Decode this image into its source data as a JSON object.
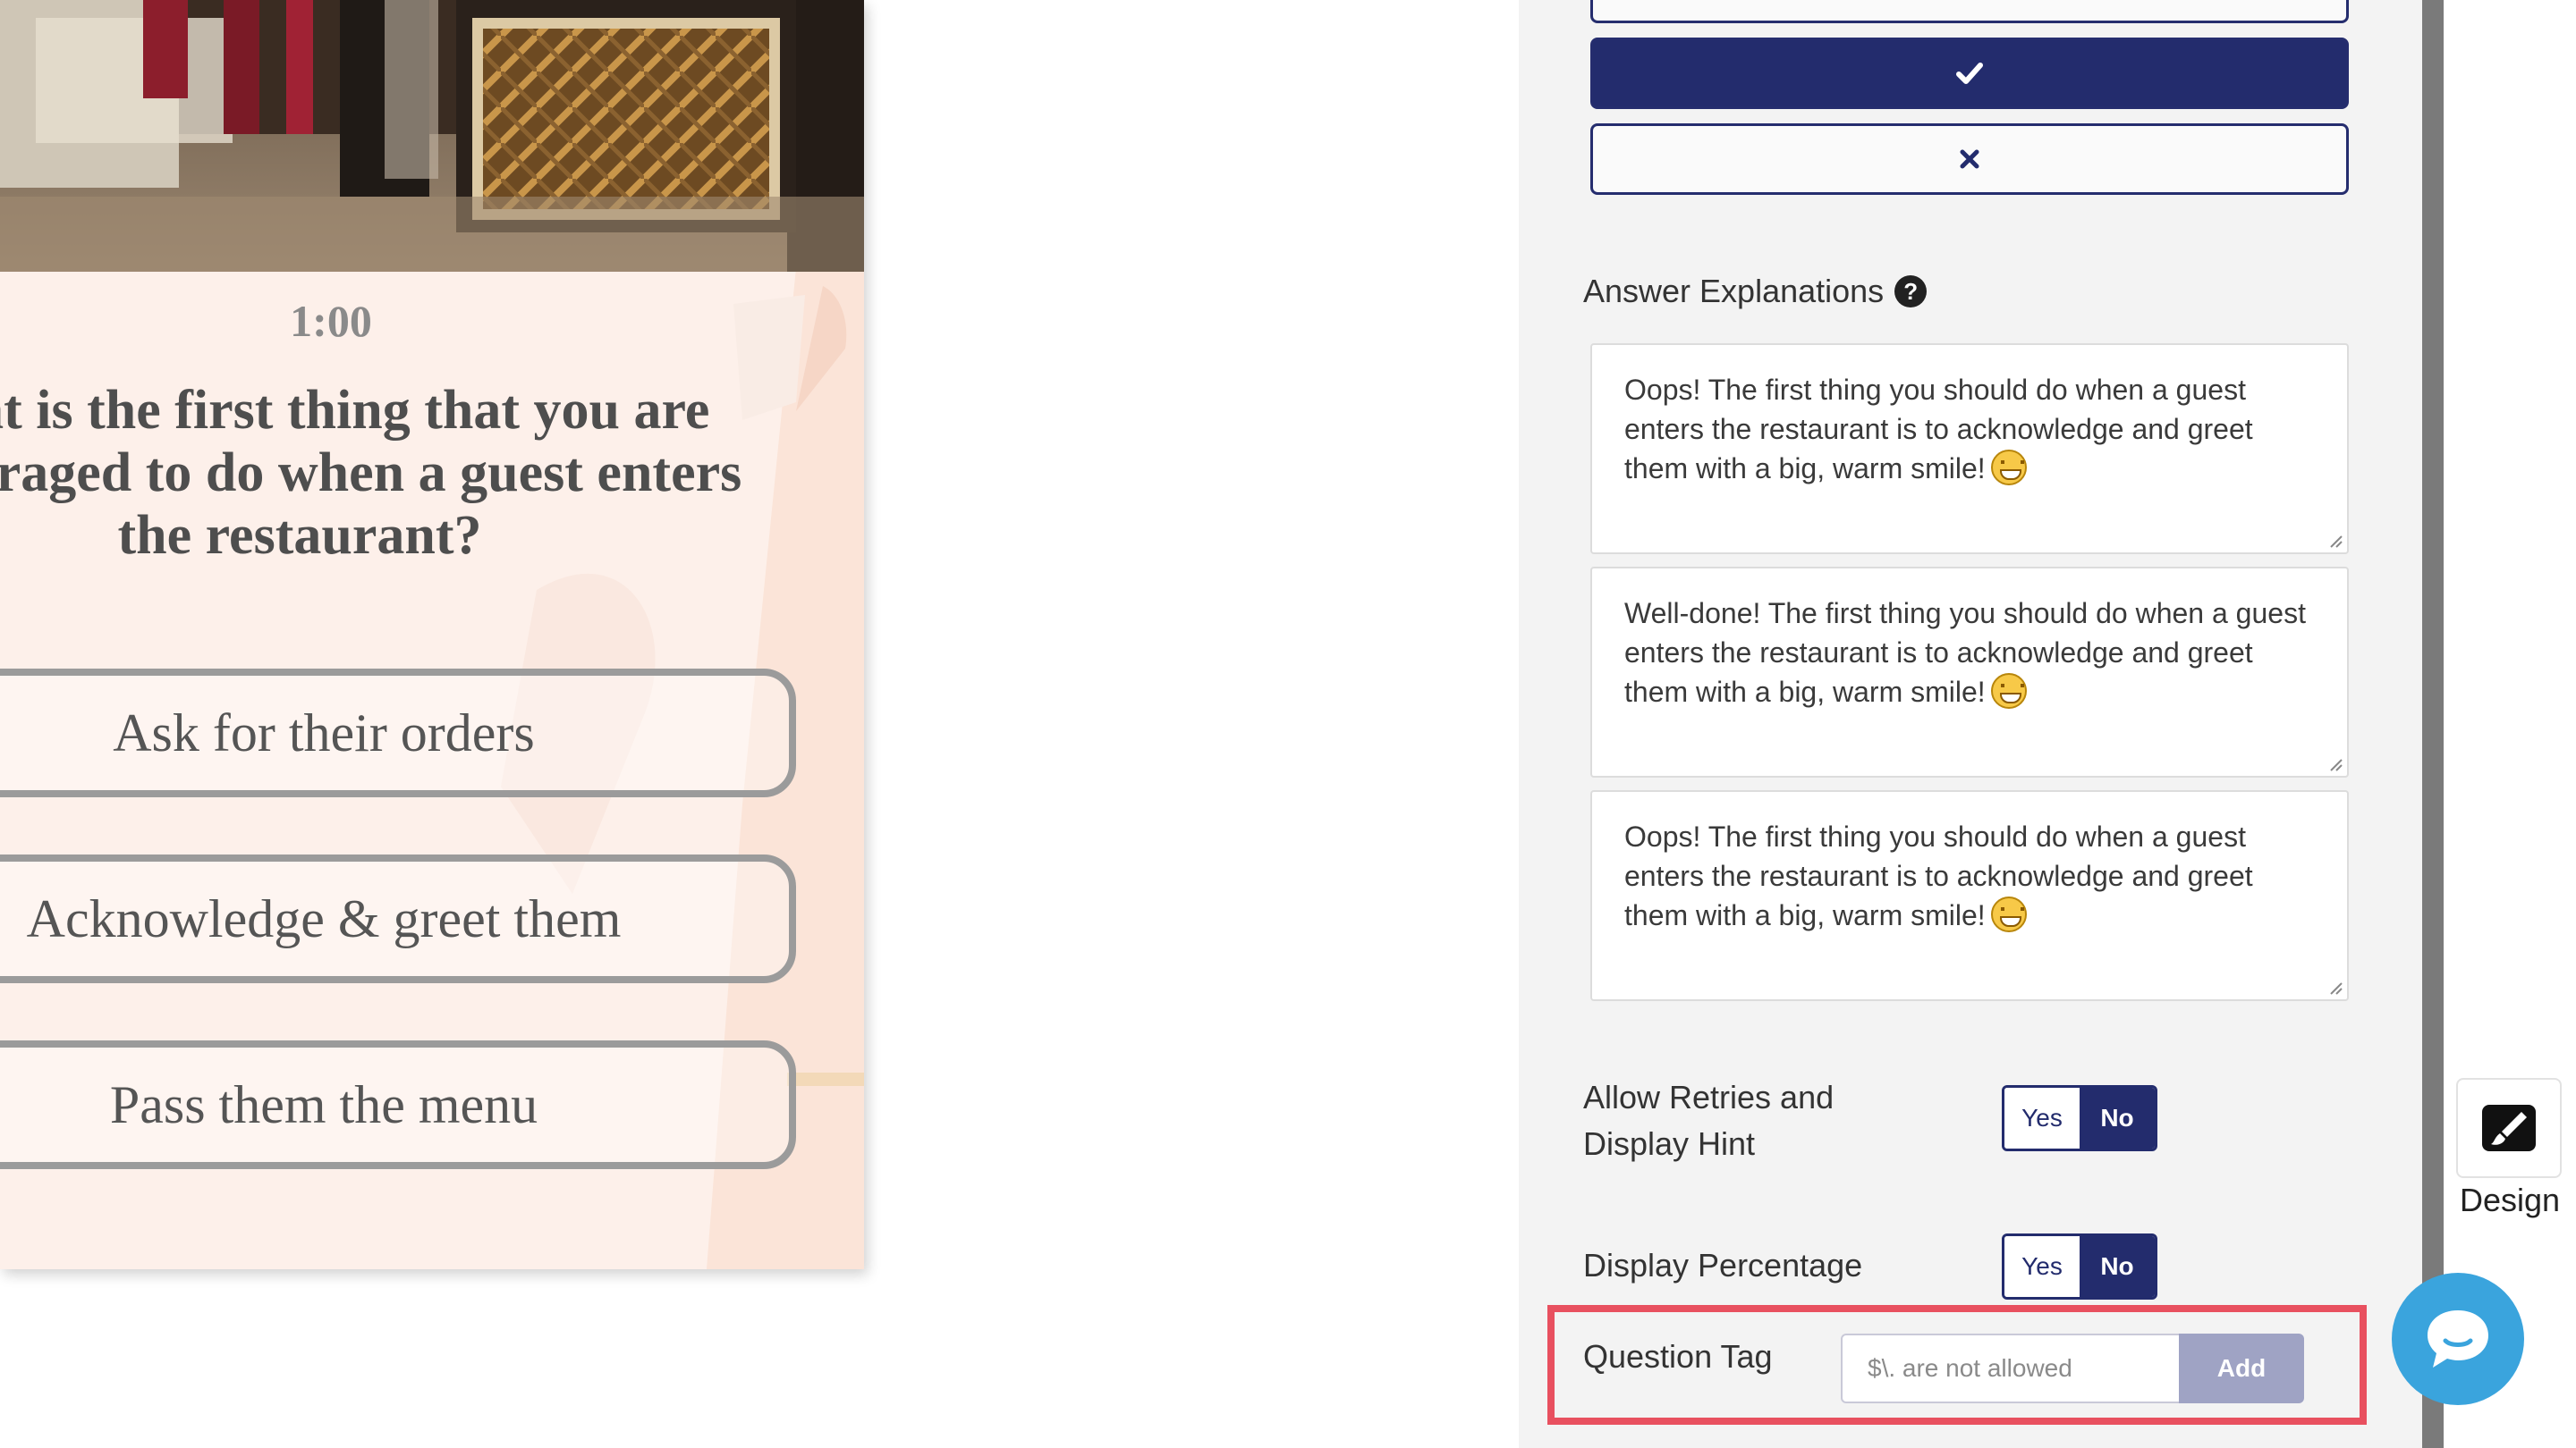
{
  "preview": {
    "timer": "1:00",
    "question": "What is the first thing that you are encouraged to do when a guest enters the restaurant?",
    "answers": [
      {
        "label": "Ask for their orders"
      },
      {
        "label": "Acknowledge & greet them"
      },
      {
        "label": "Pass them the menu"
      }
    ]
  },
  "editor": {
    "markers": [
      "check-icon",
      "x-icon"
    ],
    "answer_explanations": {
      "label": "Answer Explanations",
      "items": [
        "Oops! The first thing you should do when a guest enters the restaurant is to acknowledge and greet them with a big, warm smile!",
        "Well-done! The first thing you should do when a guest enters the restaurant is to acknowledge and greet them with a big, warm smile!",
        "Oops! The first thing you should do when a guest enters the restaurant is to acknowledge and greet them with a big, warm smile!"
      ]
    },
    "allow_retries": {
      "line1": "Allow Retries and",
      "line2": "Display Hint",
      "yes": "Yes",
      "no": "No",
      "selected": "No"
    },
    "display_percentage": {
      "label": "Display Percentage",
      "yes": "Yes",
      "no": "No",
      "selected": "No"
    },
    "question_tag": {
      "label": "Question Tag",
      "placeholder": "$\\. are not allowed",
      "value": "",
      "add_label": "Add"
    }
  },
  "design": {
    "label": "Design"
  },
  "colors": {
    "navy": "#232c6d",
    "highlight": "#e8505f",
    "chat": "#3aa4dd",
    "card_bg": "#fdf0ea"
  }
}
